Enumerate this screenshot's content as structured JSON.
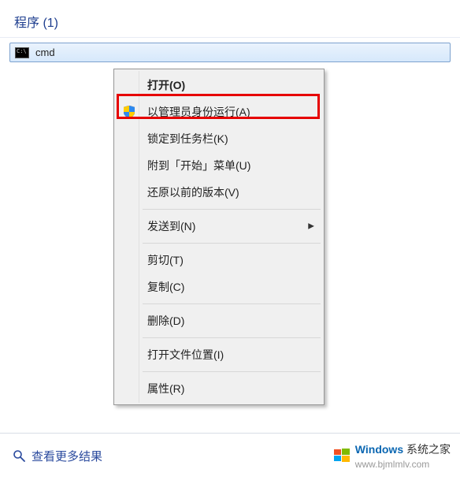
{
  "header": {
    "category": "程序 (1)"
  },
  "result": {
    "label": "cmd"
  },
  "context_menu": {
    "open": "打开(O)",
    "run_as_admin": "以管理员身份运行(A)",
    "pin_taskbar": "锁定到任务栏(K)",
    "pin_start": "附到「开始」菜单(U)",
    "restore_prev": "还原以前的版本(V)",
    "send_to": "发送到(N)",
    "cut": "剪切(T)",
    "copy": "复制(C)",
    "delete": "删除(D)",
    "open_location": "打开文件位置(I)",
    "properties": "属性(R)"
  },
  "footer": {
    "more_results": "查看更多结果"
  },
  "watermark": {
    "brand": "Windows",
    "cn": "系统之家",
    "url": "www.bjmlmlv.com"
  }
}
